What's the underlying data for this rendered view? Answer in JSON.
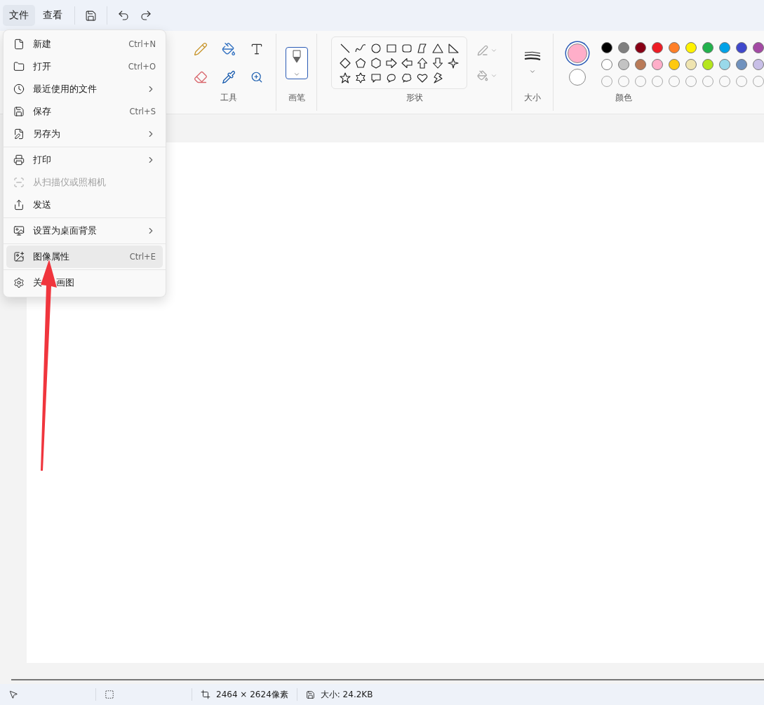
{
  "menubar": {
    "menus": [
      {
        "label": "文件",
        "selected": true
      },
      {
        "label": "查看",
        "selected": false
      }
    ]
  },
  "file_menu": {
    "sections": [
      [
        {
          "label": "新建",
          "shortcut": "Ctrl+N",
          "submenu": false,
          "disabled": false,
          "selected": false
        },
        {
          "label": "打开",
          "shortcut": "Ctrl+O",
          "submenu": false,
          "disabled": false,
          "selected": false
        },
        {
          "label": "最近使用的文件",
          "submenu": true,
          "disabled": false,
          "selected": false
        },
        {
          "label": "保存",
          "shortcut": "Ctrl+S",
          "submenu": false,
          "disabled": false,
          "selected": false
        },
        {
          "label": "另存为",
          "submenu": true,
          "disabled": false,
          "selected": false
        }
      ],
      [
        {
          "label": "打印",
          "submenu": true,
          "disabled": false,
          "selected": false
        },
        {
          "label": "从扫描仪或照相机",
          "submenu": false,
          "disabled": true,
          "selected": false
        },
        {
          "label": "发送",
          "submenu": false,
          "disabled": false,
          "selected": false
        }
      ],
      [
        {
          "label": "设置为桌面背景",
          "submenu": true,
          "disabled": false,
          "selected": false
        }
      ],
      [
        {
          "label": "图像属性",
          "shortcut": "Ctrl+E",
          "submenu": false,
          "disabled": false,
          "selected": true
        }
      ],
      [
        {
          "label": "关 画图",
          "submenu": false,
          "disabled": false,
          "selected": false
        }
      ]
    ]
  },
  "ribbon": {
    "groups": [
      {
        "kind": "tools",
        "label": "工具"
      },
      {
        "kind": "brushes",
        "label": "画笔",
        "selected": true
      },
      {
        "kind": "shapes",
        "label": "形状"
      },
      {
        "kind": "size",
        "label": "大小"
      },
      {
        "kind": "colors",
        "label": "颜色",
        "current": [
          {
            "color": "#ffaec9",
            "selected": true
          },
          {
            "color": "#ffffff",
            "selected": false
          }
        ],
        "palette": [
          {
            "kind": "filled",
            "color": "#000000"
          },
          {
            "kind": "filled",
            "color": "#7f7f7f"
          },
          {
            "kind": "filled",
            "color": "#880015"
          },
          {
            "kind": "filled",
            "color": "#ed1c24"
          },
          {
            "kind": "filled",
            "color": "#ff7f27"
          },
          {
            "kind": "filled",
            "color": "#fff200"
          },
          {
            "kind": "filled",
            "color": "#22b14c"
          },
          {
            "kind": "filled",
            "color": "#00a2e8"
          },
          {
            "kind": "filled",
            "color": "#3f48cc"
          },
          {
            "kind": "filled",
            "color": "#a349a4"
          },
          {
            "kind": "filled",
            "color": "#ffffff"
          },
          {
            "kind": "filled",
            "color": "#c3c3c3"
          },
          {
            "kind": "filled",
            "color": "#b97a57"
          },
          {
            "kind": "filled",
            "color": "#ffaec9"
          },
          {
            "kind": "filled",
            "color": "#ffc90e"
          },
          {
            "kind": "filled",
            "color": "#efe4b0"
          },
          {
            "kind": "filled",
            "color": "#b5e61d"
          },
          {
            "kind": "filled",
            "color": "#99d9ea"
          },
          {
            "kind": "filled",
            "color": "#7092be"
          },
          {
            "kind": "filled",
            "color": "#c8bfe7"
          },
          {
            "kind": "empty"
          },
          {
            "kind": "empty"
          },
          {
            "kind": "empty"
          },
          {
            "kind": "empty"
          },
          {
            "kind": "empty"
          },
          {
            "kind": "empty"
          },
          {
            "kind": "empty"
          },
          {
            "kind": "empty"
          },
          {
            "kind": "empty"
          },
          {
            "kind": "empty"
          }
        ]
      }
    ]
  },
  "status_bar": {
    "canvas_size": "2464 × 2624像素",
    "file_size": "大小: 24.2KB"
  }
}
